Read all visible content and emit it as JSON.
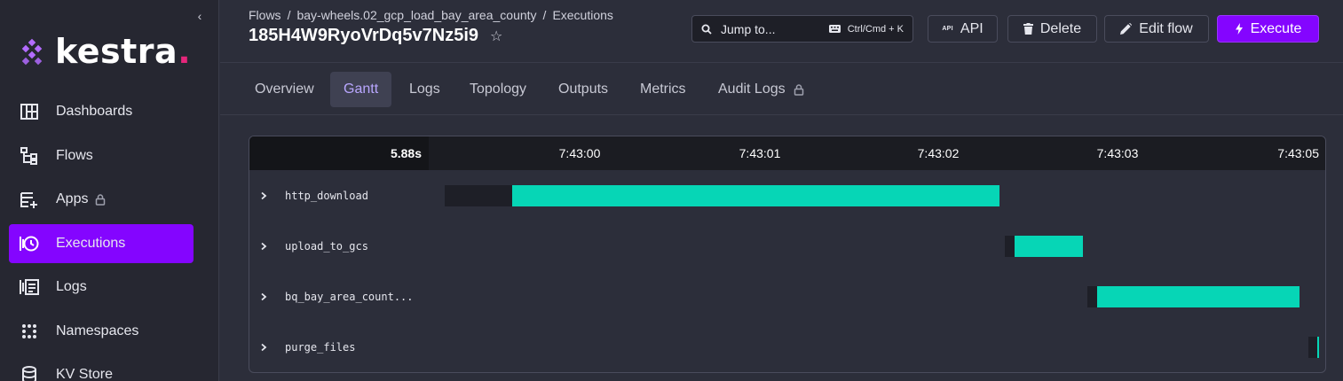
{
  "sidebar": {
    "brand": "kestra",
    "brand_dot": ".",
    "items": [
      {
        "label": "Dashboards",
        "icon": "dashboard-icon",
        "active": false,
        "locked": false
      },
      {
        "label": "Flows",
        "icon": "flows-icon",
        "active": false,
        "locked": false
      },
      {
        "label": "Apps",
        "icon": "apps-icon",
        "active": false,
        "locked": true
      },
      {
        "label": "Executions",
        "icon": "executions-icon",
        "active": true,
        "locked": false
      },
      {
        "label": "Logs",
        "icon": "logs-icon",
        "active": false,
        "locked": false
      },
      {
        "label": "Namespaces",
        "icon": "namespaces-icon",
        "active": false,
        "locked": false
      },
      {
        "label": "KV Store",
        "icon": "database-icon",
        "active": false,
        "locked": false
      }
    ]
  },
  "header": {
    "breadcrumb": [
      "Flows",
      "bay-wheels.02_gcp_load_bay_area_county",
      "Executions"
    ],
    "breadcrumb_sep": "/",
    "title": "185H4W9RyoVrDq5v7Nz5i9",
    "search": {
      "label": "Jump to...",
      "shortcut": "Ctrl/Cmd + K"
    },
    "buttons": {
      "api": "API",
      "delete": "Delete",
      "edit": "Edit flow",
      "execute": "Execute"
    }
  },
  "tabs": [
    {
      "label": "Overview",
      "active": false
    },
    {
      "label": "Gantt",
      "active": true
    },
    {
      "label": "Logs",
      "active": false
    },
    {
      "label": "Topology",
      "active": false
    },
    {
      "label": "Outputs",
      "active": false
    },
    {
      "label": "Metrics",
      "active": false
    },
    {
      "label": "Audit Logs",
      "active": false,
      "locked": true
    }
  ],
  "gantt": {
    "duration": "5.88s",
    "ticks": [
      "7:43:00",
      "7:43:01",
      "7:43:02",
      "7:43:03",
      "7:43:05"
    ],
    "rows": [
      {
        "name": "http_download"
      },
      {
        "name": "upload_to_gcs"
      },
      {
        "name": "bq_bay_area_count..."
      },
      {
        "name": "purge_files"
      }
    ]
  },
  "colors": {
    "accent": "#8405ff",
    "running_bar": "#06d6b6",
    "waiting_bar": "#1e1f27",
    "active_tab_text": "#b9a7ff"
  }
}
